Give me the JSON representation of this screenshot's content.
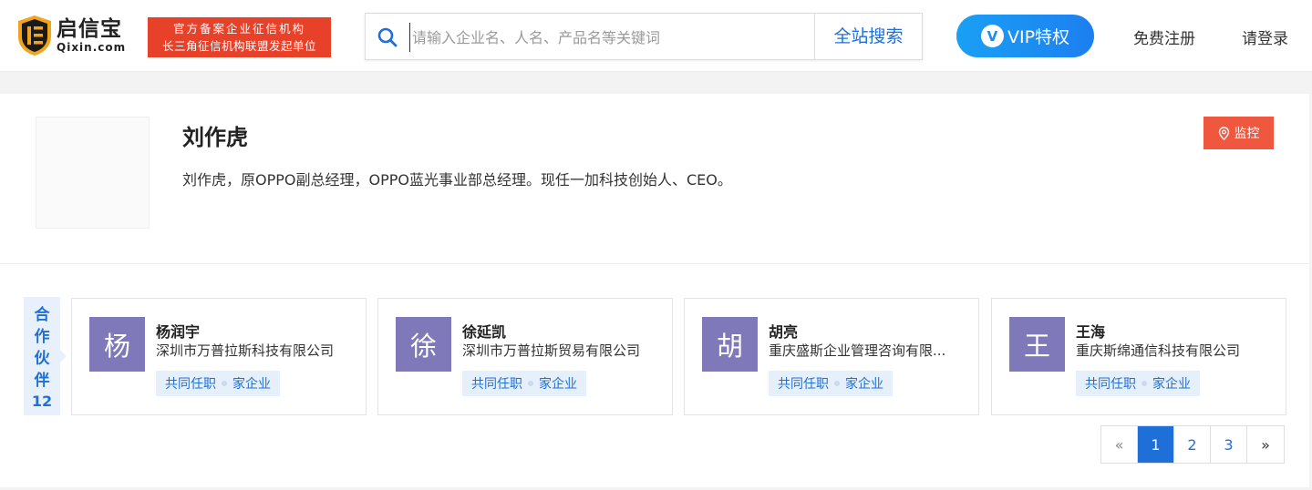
{
  "header": {
    "logo_cn": "启信宝",
    "logo_en": "Qixin.com",
    "cert_line1": "官方备案企业征信机构",
    "cert_line2": "长三角征信机构联盟发起单位",
    "search_placeholder": "请输入企业名、人名、产品名等关键词",
    "search_button": "全站搜索",
    "vip_label": "VIP特权",
    "vip_badge": "V",
    "register": "免费注册",
    "login": "请登录"
  },
  "profile": {
    "name": "刘作虎",
    "description": "刘作虎，原OPPO副总经理，OPPO蓝光事业部总经理。现任一加科技创始人、CEO。",
    "monitor_button": "监控"
  },
  "partners": {
    "tab_chars": [
      "合",
      "作",
      "伙",
      "伴"
    ],
    "count": "12",
    "items": [
      {
        "avatar_char": "杨",
        "name": "杨润宇",
        "company": "深圳市万普拉斯科技有限公司",
        "tag_a": "共同任职",
        "tag_b": "家企业"
      },
      {
        "avatar_char": "徐",
        "name": "徐延凯",
        "company": "深圳市万普拉斯贸易有限公司",
        "tag_a": "共同任职",
        "tag_b": "家企业"
      },
      {
        "avatar_char": "胡",
        "name": "胡亮",
        "company": "重庆盛斯企业管理咨询有限...",
        "tag_a": "共同任职",
        "tag_b": "家企业"
      },
      {
        "avatar_char": "王",
        "name": "王海",
        "company": "重庆斯绵通信科技有限公司",
        "tag_a": "共同任职",
        "tag_b": "家企业"
      }
    ]
  },
  "pagination": {
    "prev": "«",
    "pages": [
      "1",
      "2",
      "3"
    ],
    "next": "»",
    "current": "1"
  },
  "colors": {
    "brand_blue": "#1f6fd8",
    "cert_red": "#e8412a",
    "monitor_red": "#f0573f",
    "avatar_purple": "#7f78b9",
    "logo_orange": "#f0a020"
  }
}
